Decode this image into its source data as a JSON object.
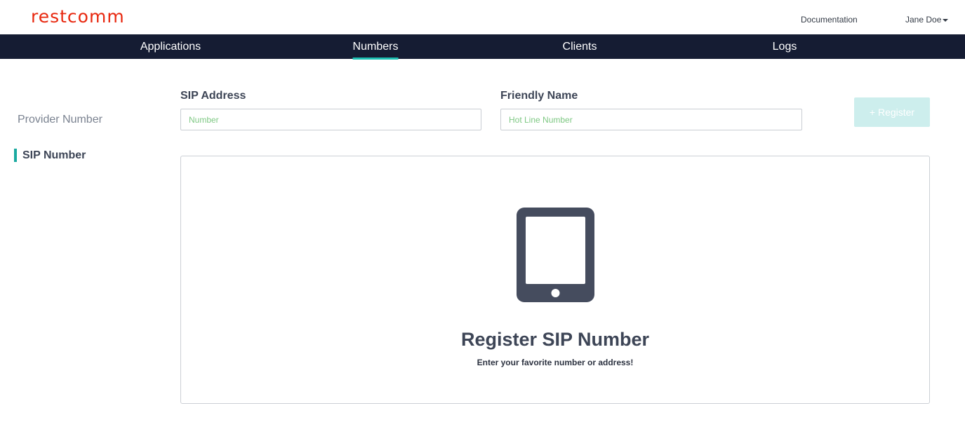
{
  "header": {
    "logo": "restcomm",
    "documentation_label": "Documentation",
    "user_name": "Jane Doe"
  },
  "nav": {
    "items": [
      {
        "label": "Applications",
        "active": false
      },
      {
        "label": "Numbers",
        "active": true
      },
      {
        "label": "Clients",
        "active": false
      },
      {
        "label": "Logs",
        "active": false
      }
    ]
  },
  "sidebar": {
    "items": [
      {
        "label": "Provider Number",
        "active": false
      },
      {
        "label": "SIP Number",
        "active": true
      }
    ]
  },
  "form": {
    "sip_address": {
      "label": "SIP Address",
      "placeholder": "Number",
      "value": ""
    },
    "friendly_name": {
      "label": "Friendly Name",
      "placeholder": "Hot Line Number",
      "value": ""
    },
    "register_label": "+ Register"
  },
  "empty_state": {
    "icon": "tablet-icon",
    "title": "Register SIP Number",
    "subtitle": "Enter your favorite number or address!"
  },
  "colors": {
    "brand": "#e8280f",
    "navbar_bg": "#151c33",
    "accent": "#1dbfb2",
    "register_button_bg": "#cdeeed",
    "placeholder": "#7ec883",
    "icon": "#454c5e"
  }
}
